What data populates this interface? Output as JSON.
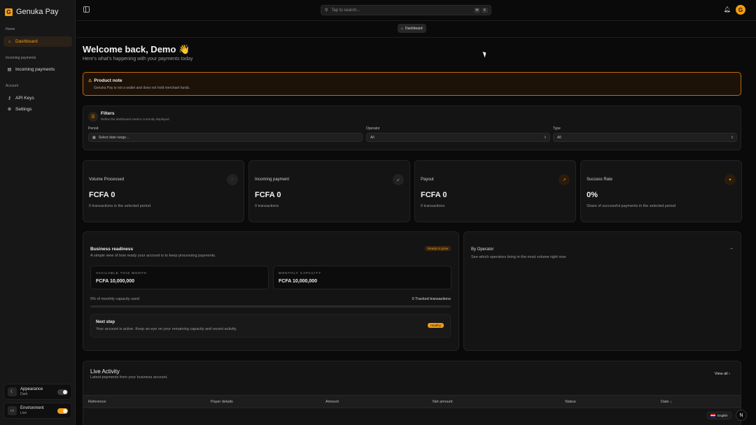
{
  "brand": {
    "logo": "G",
    "name": "Genuka Pay"
  },
  "sidebar": {
    "groups": [
      "Home",
      "Incoming payments",
      "Account"
    ],
    "items": [
      {
        "label": "Dashboard",
        "icon": "home-icon",
        "active": true
      },
      {
        "label": "Incoming payments",
        "icon": "receipt-icon"
      },
      {
        "label": "API Keys",
        "icon": "key-icon"
      },
      {
        "label": "Settings",
        "icon": "gear-icon"
      }
    ],
    "appearance": {
      "label": "Appearance",
      "value": "Dark"
    },
    "environment": {
      "label": "Environment",
      "value": "Live"
    }
  },
  "topbar": {
    "search_placeholder": "Tap to search...",
    "kbd1": "⌘",
    "kbd2": "K",
    "avatar": "G"
  },
  "breadcrumb": "Dashboard",
  "welcome": {
    "title": "Welcome back, Demo 👋",
    "subtitle": "Here's what's happening with your payments today"
  },
  "note": {
    "title": "Product note",
    "text": "Genuka Pay is not a wallet and does not hold merchant funds."
  },
  "filters": {
    "title": "Filters",
    "subtitle": "Refine the dashboard metrics currently displayed.",
    "period_label": "Period",
    "period_placeholder": "Select date range...",
    "operator_label": "Operator",
    "operator_value": "All",
    "type_label": "Type",
    "type_value": "All"
  },
  "metrics": [
    {
      "title": "Volume Processed",
      "value": "FCFA 0",
      "sub": "0 transactions in the selected period"
    },
    {
      "title": "Incoming payment",
      "value": "FCFA 0",
      "sub": "0 transactions"
    },
    {
      "title": "Payout",
      "value": "FCFA 0",
      "sub": "0 transactions"
    },
    {
      "title": "Success Rate",
      "value": "0%",
      "sub": "Share of successful payments in the selected period"
    }
  ],
  "business": {
    "title": "Business readiness",
    "subtitle": "A simple view of how ready your account is to keep processing payments.",
    "badge": "Ready to grow",
    "available_label": "AVAILABLE THIS MONTH",
    "available_value": "FCFA 10,000,000",
    "capacity_label": "MONTHLY CAPACITY",
    "capacity_value": "FCFA 10,000,000",
    "used_text": "0% of monthly capacity used",
    "used_fraction": 0,
    "tracked": "0 Tracked transactions",
    "next_title": "Next step",
    "next_text": "Your account is active. Keep an eye on your remaining capacity and recent activity.",
    "next_badge": "Healthy"
  },
  "operator": {
    "title": "By Operator",
    "subtitle": "See which operators bring in the most volume right now"
  },
  "live": {
    "title": "Live Activity",
    "subtitle": "Latest payments from your business account.",
    "view_all": "View all",
    "columns": [
      "Reference",
      "Payer details",
      "Amount",
      "Net amount",
      "Status",
      "Date"
    ]
  },
  "language": "English",
  "n_button": "N",
  "colors": {
    "accent": "#f39c12",
    "background": "#0a0a0a",
    "card": "#141414"
  }
}
